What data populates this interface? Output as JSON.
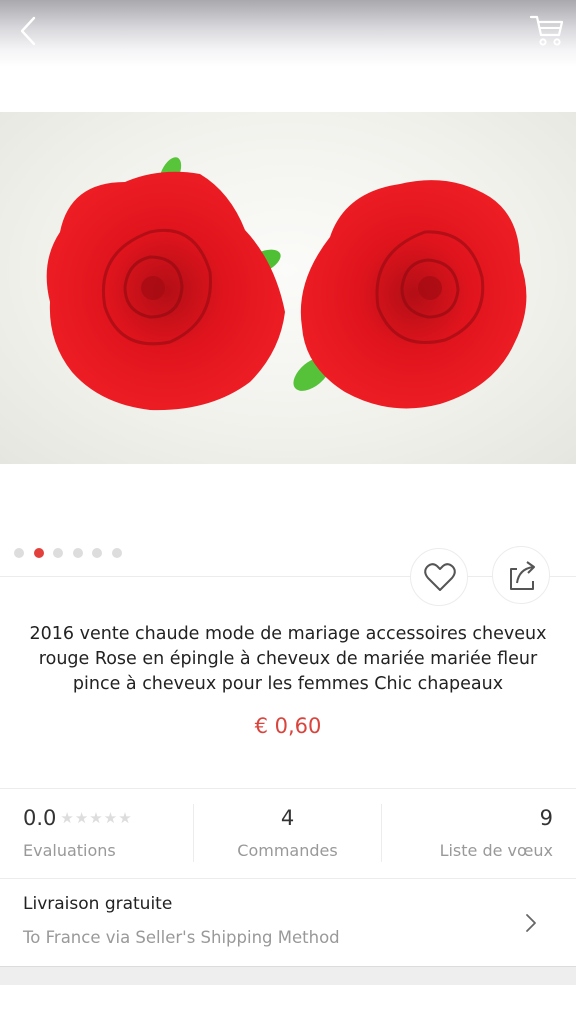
{
  "header": {
    "back_icon": "chevron-left-icon",
    "cart_icon": "cart-icon"
  },
  "product": {
    "image_description_icon": "red-rose-hair-clips-image",
    "gallery": {
      "count": 6,
      "active_index": 1,
      "active_color": "#e2413b"
    },
    "title": "2016 vente chaude mode de mariage accessoires cheveux rouge Rose en épingle à cheveux de mariée mariée fleur pince à cheveux pour les femmes Chic chapeaux",
    "price": "€ 0,60",
    "price_color": "#d9443c"
  },
  "actions": {
    "wishlist_icon": "heart-icon",
    "share_icon": "share-icon"
  },
  "stats": {
    "rating": {
      "value": "0.0",
      "label": "Evaluations",
      "stars": "★★★★★",
      "stars_filled": 0
    },
    "orders": {
      "value": "4",
      "label": "Commandes"
    },
    "wishlist": {
      "value": "9",
      "label": "Liste de vœux"
    }
  },
  "shipping": {
    "title": "Livraison gratuite",
    "subtitle": "To France via Seller's Shipping Method"
  }
}
